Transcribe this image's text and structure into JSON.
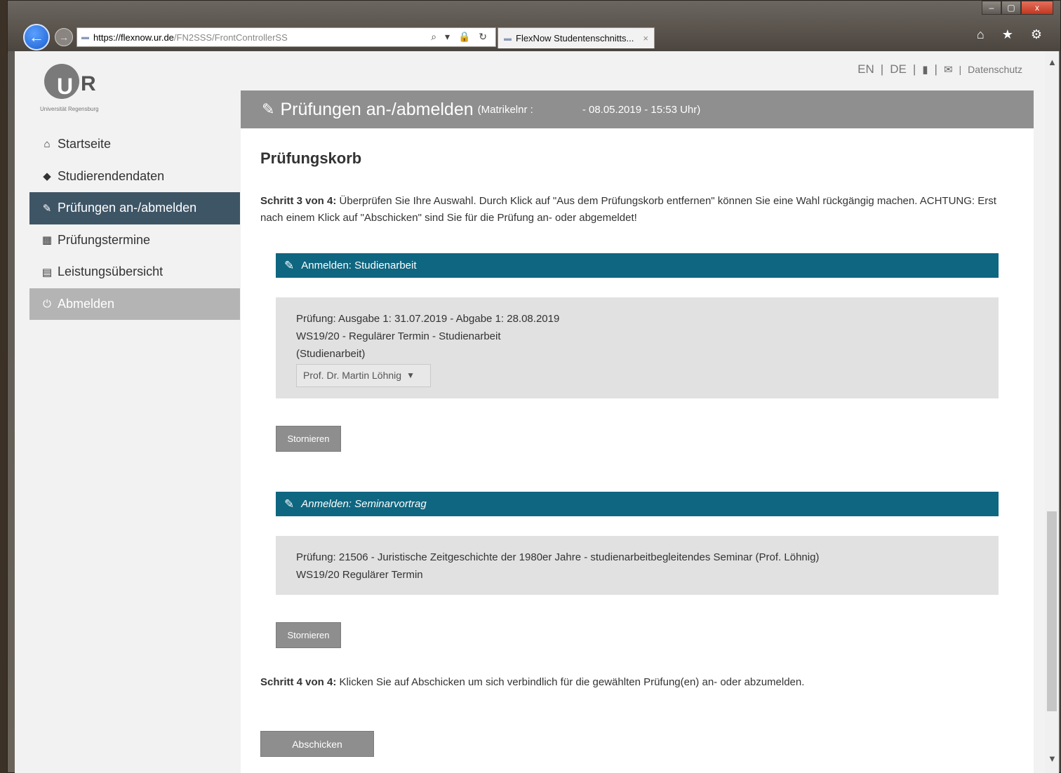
{
  "browser": {
    "url_host": "https://flexnow.ur.de",
    "url_path": "/FN2SSS/FrontControllerSS",
    "tab_title": "FlexNow Studentenschnitts...",
    "tab_close": "×",
    "back_glyph": "←",
    "forward_glyph": "→",
    "address_icons": "⌕ ▾ 🔒 ↻",
    "window_controls": [
      "–",
      "▢",
      "x"
    ],
    "toolbar_icons": "⌂ ★ ⚙"
  },
  "logo": {
    "letter_u": "U",
    "letter_r": "R",
    "subtitle": "Universität Regensburg"
  },
  "header": {
    "lang_en": "EN",
    "lang_de": "DE",
    "sep": "|",
    "privacy": "Datenschutz"
  },
  "sidebar": {
    "items": [
      {
        "label": "Startseite",
        "icon": "home-icon"
      },
      {
        "label": "Studierendendaten",
        "icon": "graduation-cap-icon"
      },
      {
        "label": "Prüfungen an-/abmelden",
        "icon": "edit-icon"
      },
      {
        "label": "Prüfungstermine",
        "icon": "calendar-icon"
      },
      {
        "label": "Leistungsübersicht",
        "icon": "list-icon"
      },
      {
        "label": "Abmelden",
        "icon": "power-icon"
      }
    ]
  },
  "panel": {
    "title": "Prüfungen an-/abmelden",
    "matrikel": "(Matrikelnr :",
    "date": "- 08.05.2019 - 15:53 Uhr)"
  },
  "content": {
    "heading": "Prüfungskorb",
    "step3_label": "Schritt 3 von 4:",
    "step3_text": " Überprüfen Sie Ihre Auswahl. Durch Klick auf \"Aus dem Prüfungskorb entfernen\" können Sie eine Wahl rückgängig machen. ACHTUNG: Erst nach einem Klick auf \"Abschicken\" sind Sie für die Prüfung an- oder abgemeldet!",
    "step4_label": "Schritt 4 von 4:",
    "step4_text": " Klicken Sie auf Abschicken um sich verbindlich für die gewählten Prüfung(en) an- oder abzumelden.",
    "submit_label": "Abschicken"
  },
  "sections": [
    {
      "header": "Anmelden: Studienarbeit",
      "lines": [
        "Prüfung: Ausgabe 1: 31.07.2019 - Abgabe 1: 28.08.2019",
        "WS19/20 - Regulärer Termin - Studienarbeit",
        "(Studienarbeit)"
      ],
      "examiner_selected": "Prof. Dr. Martin Löhnig",
      "cancel_label": "Stornieren"
    },
    {
      "header": "Anmelden: Seminarvortrag",
      "lines": [
        "Prüfung: 21506 - Juristische Zeitgeschichte der 1980er Jahre - studienarbeitbegleitendes Seminar (Prof. Löhnig)",
        "WS19/20 Regulärer Termin"
      ],
      "cancel_label": "Stornieren"
    }
  ],
  "colors": {
    "section_bar": "#0f6680",
    "active_nav": "#3e5566",
    "panel_header": "#8f8f8f"
  }
}
